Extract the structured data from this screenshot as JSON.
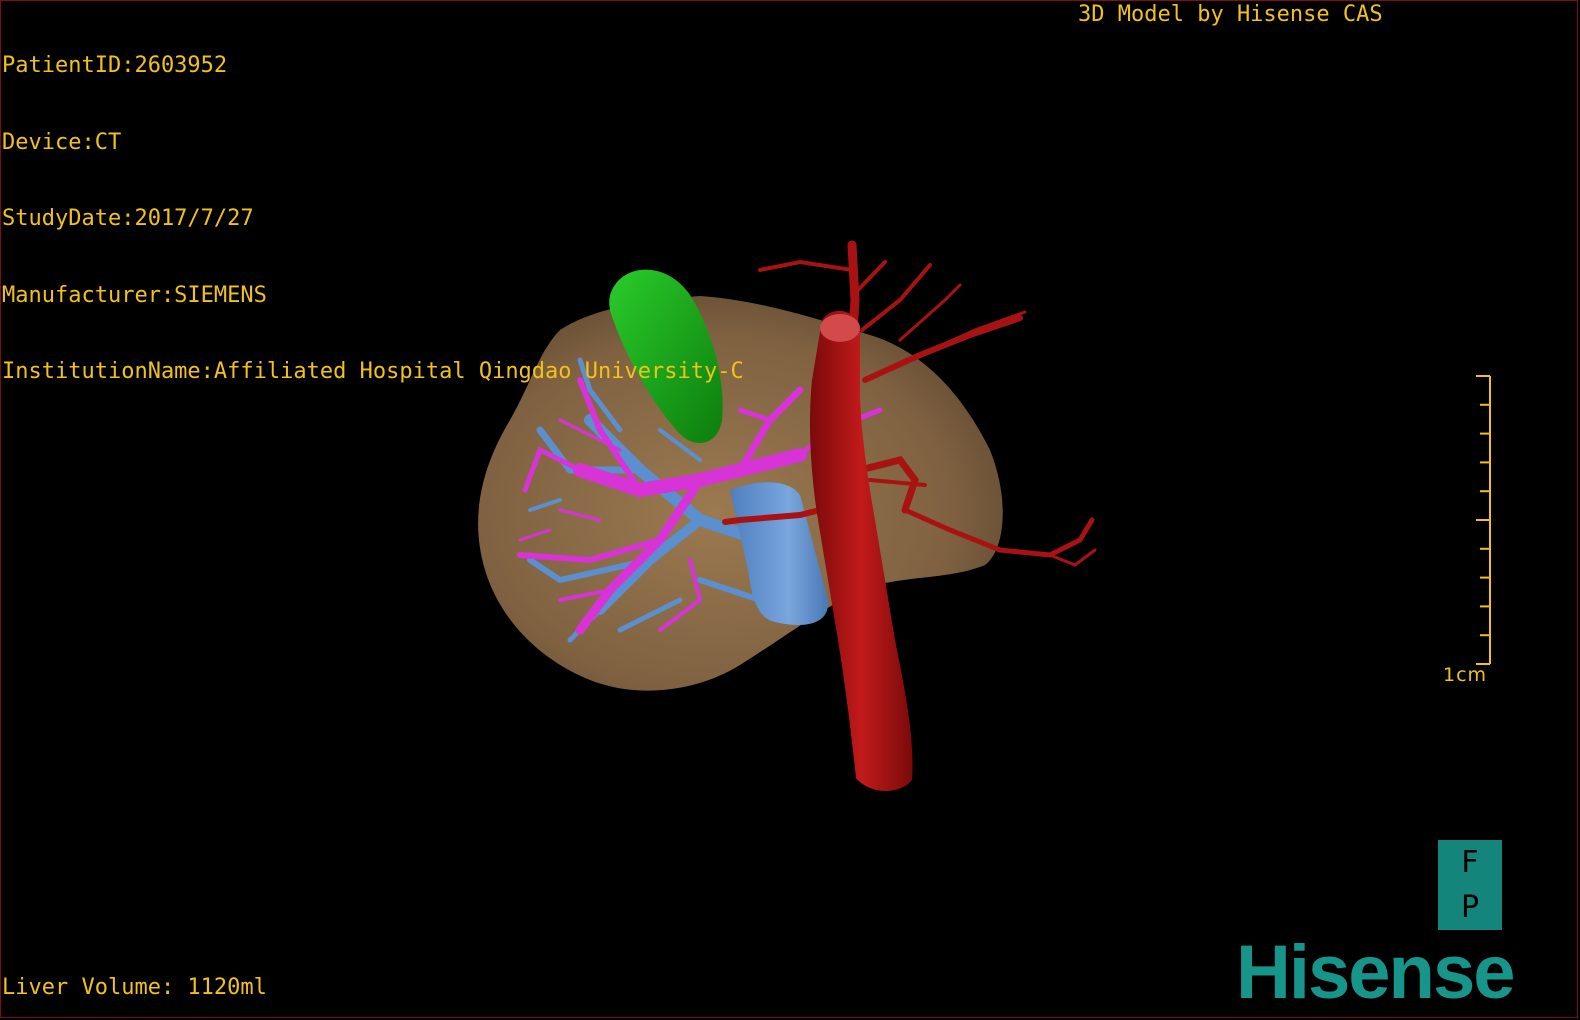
{
  "overlay": {
    "patient_id": "PatientID:2603952",
    "device": "Device:CT",
    "study_date": "StudyDate:2017/7/27",
    "manufacturer": "Manufacturer:SIEMENS",
    "institution": "InstitutionName:Affiliated Hospital Qingdao University-C",
    "credit": "3D Model by Hisense CAS",
    "liver_volume": "Liver Volume: 1120ml"
  },
  "scale_bar": {
    "label": "1cm",
    "color": "#f2c21a"
  },
  "orientation": {
    "top": "F",
    "bottom": "P",
    "bg_color": "#14857a"
  },
  "brand": {
    "name": "Hisense",
    "color": "#17958a"
  },
  "model_colors": {
    "liver": "#8a6a45",
    "gallbladder": "#1aa61a",
    "portal_vein": "#d733d7",
    "hepatic_vein": "#5b8fd0",
    "artery": "#a81212"
  }
}
